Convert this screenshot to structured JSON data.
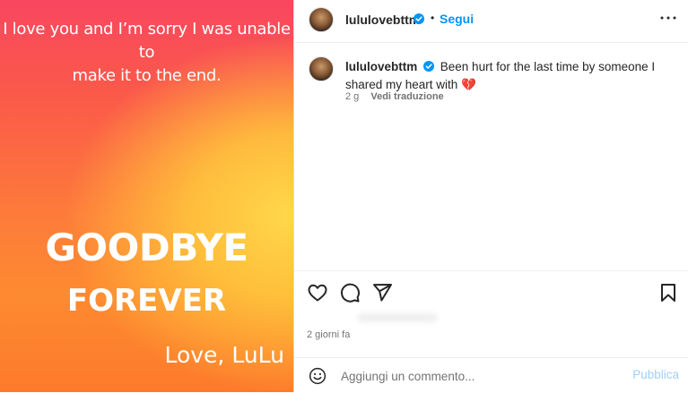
{
  "story": {
    "line1": "I love you and I’m sorry I was unable to",
    "line2": "make it to the end.",
    "headline1": "GOODBYE",
    "headline2": "FOREVER",
    "signature": "Love, LuLu"
  },
  "header": {
    "username": "lululovebttm",
    "separator": "•",
    "follow_label": "Segui"
  },
  "caption": {
    "username": "lululovebttm",
    "text": "Been hurt for the last time by someone I shared my heart with 💔",
    "age": "2 g",
    "translate_label": "Vedi traduzione"
  },
  "post": {
    "time_ago": "2 giorni fa"
  },
  "comment": {
    "placeholder": "Aggiungi un commento...",
    "publish_label": "Pubblica"
  },
  "colors": {
    "accent": "#0095f6",
    "verified": "#0095f6",
    "publish_disabled": "#a0cff8"
  }
}
